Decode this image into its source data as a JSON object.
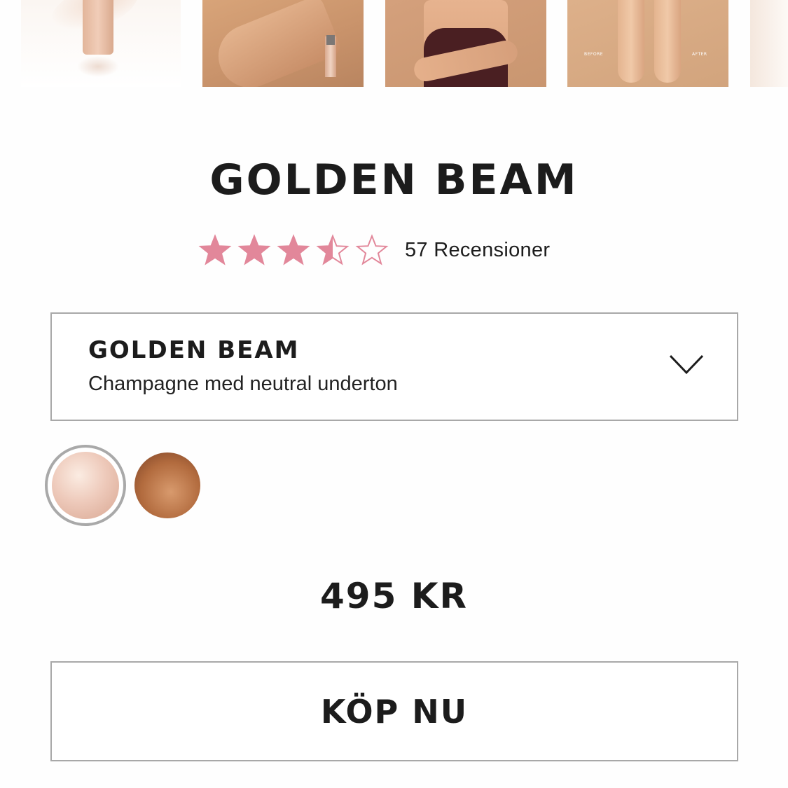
{
  "gallery": {
    "thumbnails": [
      {
        "name": "product-bottle-image"
      },
      {
        "name": "legs-application-image"
      },
      {
        "name": "model-torso-image"
      },
      {
        "name": "before-after-legs-image",
        "tags": [
          "BEFORE",
          "AFTER"
        ]
      },
      {
        "name": "partial-next-image"
      }
    ]
  },
  "product": {
    "title": "GOLDEN BEAM",
    "rating": {
      "value": 3.5,
      "max": 5,
      "star_color": "#e2879a",
      "reviews_label": "57 Recensioner"
    },
    "variant_select": {
      "name": "GOLDEN BEAM",
      "description": "Champagne med neutral underton"
    },
    "swatches": [
      {
        "name": "swatch-champagne",
        "selected": true
      },
      {
        "name": "swatch-bronze",
        "selected": false
      }
    ],
    "price": "495 KR",
    "buy_label": "KÖP NU"
  }
}
